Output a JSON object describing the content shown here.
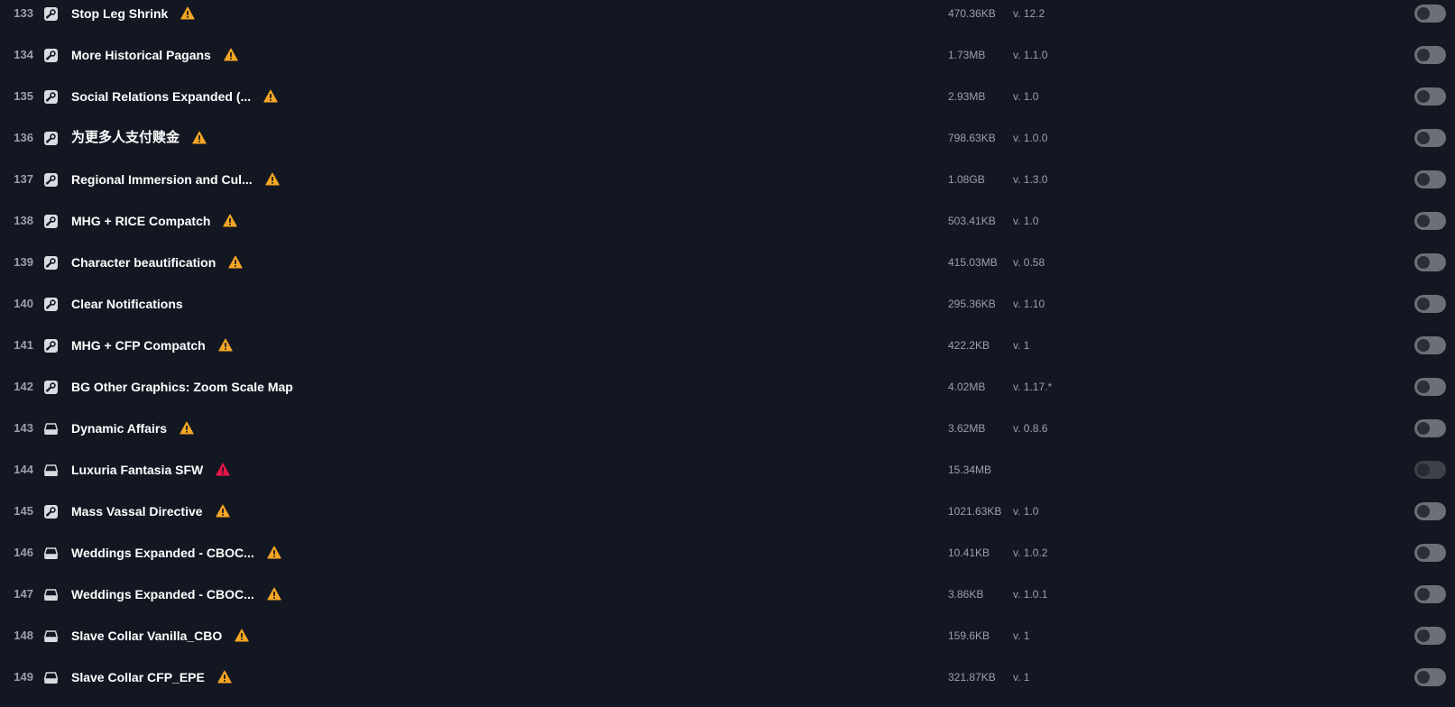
{
  "colors": {
    "background": "#131722",
    "warning": "#f5a623",
    "error": "#e8154b",
    "text_primary": "#ffffff",
    "text_secondary": "#9aa0ab"
  },
  "mods": [
    {
      "index": "133",
      "source": "steam-icon",
      "name": "Stop Leg Shrink",
      "warning": "warning",
      "size": "470.36KB",
      "version": "v. 12.2",
      "toggle": "off"
    },
    {
      "index": "134",
      "source": "steam-icon",
      "name": "More Historical Pagans",
      "warning": "warning",
      "size": "1.73MB",
      "version": "v. 1.1.0",
      "toggle": "off"
    },
    {
      "index": "135",
      "source": "steam-icon",
      "name": "Social Relations Expanded (...",
      "warning": "warning",
      "size": "2.93MB",
      "version": "v. 1.0",
      "toggle": "off"
    },
    {
      "index": "136",
      "source": "steam-icon",
      "name": "为更多人支付赎金",
      "warning": "warning",
      "size": "798.63KB",
      "version": "v. 1.0.0",
      "toggle": "off"
    },
    {
      "index": "137",
      "source": "steam-icon",
      "name": "Regional Immersion and Cul...",
      "warning": "warning",
      "size": "1.08GB",
      "version": "v. 1.3.0",
      "toggle": "off"
    },
    {
      "index": "138",
      "source": "steam-icon",
      "name": "MHG + RICE Compatch",
      "warning": "warning",
      "size": "503.41KB",
      "version": "v. 1.0",
      "toggle": "off"
    },
    {
      "index": "139",
      "source": "steam-icon",
      "name": "Character beautification",
      "warning": "warning",
      "size": "415.03MB",
      "version": "v. 0.58",
      "toggle": "off"
    },
    {
      "index": "140",
      "source": "steam-icon",
      "name": "Clear Notifications",
      "warning": "none",
      "size": "295.36KB",
      "version": "v. 1.10",
      "toggle": "off"
    },
    {
      "index": "141",
      "source": "steam-icon",
      "name": "MHG + CFP Compatch",
      "warning": "warning",
      "size": "422.2KB",
      "version": "v. 1",
      "toggle": "off"
    },
    {
      "index": "142",
      "source": "steam-icon",
      "name": "BG Other Graphics: Zoom Scale Map",
      "warning": "none",
      "size": "4.02MB",
      "version": "v. 1.17.*",
      "toggle": "off"
    },
    {
      "index": "143",
      "source": "local-drive-icon",
      "name": "Dynamic Affairs",
      "warning": "warning",
      "size": "3.62MB",
      "version": "v. 0.8.6",
      "toggle": "off"
    },
    {
      "index": "144",
      "source": "local-drive-icon",
      "name": "Luxuria Fantasia SFW",
      "warning": "error",
      "size": "15.34MB",
      "version": "",
      "toggle": "disabled"
    },
    {
      "index": "145",
      "source": "steam-icon",
      "name": "Mass Vassal Directive",
      "warning": "warning",
      "size": "1021.63KB",
      "version": "v. 1.0",
      "toggle": "off"
    },
    {
      "index": "146",
      "source": "local-drive-icon",
      "name": "Weddings Expanded - CBOC...",
      "warning": "warning",
      "size": "10.41KB",
      "version": "v. 1.0.2",
      "toggle": "off"
    },
    {
      "index": "147",
      "source": "local-drive-icon",
      "name": "Weddings Expanded - CBOC...",
      "warning": "warning",
      "size": "3.86KB",
      "version": "v. 1.0.1",
      "toggle": "off"
    },
    {
      "index": "148",
      "source": "local-drive-icon",
      "name": "Slave Collar Vanilla_CBO",
      "warning": "warning",
      "size": "159.6KB",
      "version": "v. 1",
      "toggle": "off"
    },
    {
      "index": "149",
      "source": "local-drive-icon",
      "name": "Slave Collar CFP_EPE",
      "warning": "warning",
      "size": "321.87KB",
      "version": "v. 1",
      "toggle": "off"
    }
  ]
}
